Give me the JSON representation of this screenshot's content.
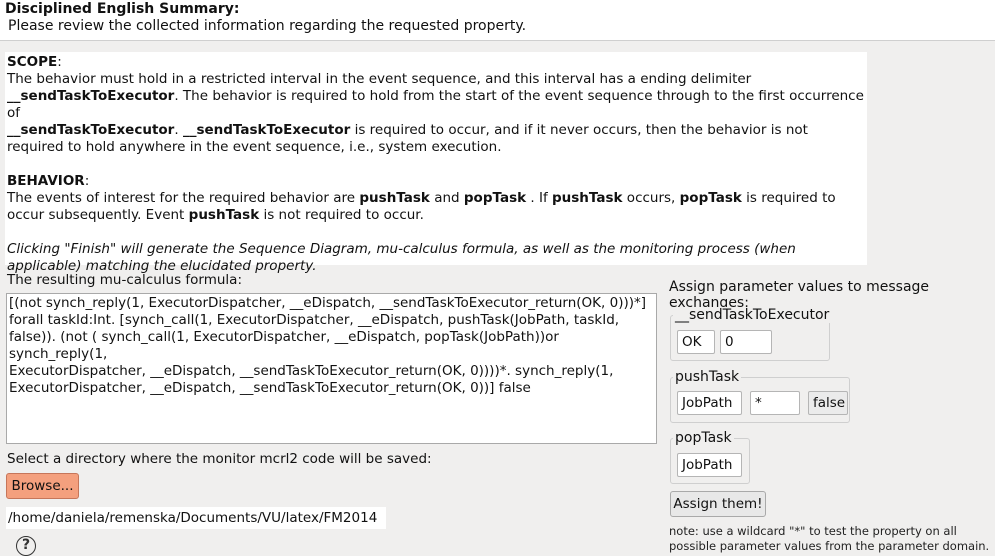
{
  "header": {
    "title": "Disciplined English Summary:",
    "subtitle": "Please review the collected information regarding the requested property."
  },
  "summary": {
    "scope_heading": "SCOPE",
    "scope_text_1": "The behavior must hold in a restricted interval in the event sequence, and this interval has a ending delimiter",
    "event_send": "__sendTaskToExecutor",
    "scope_text_2": ". The behavior is required to hold from the start of the event sequence through to the first occurrence of",
    "scope_text_3": ". ",
    "scope_text_4": " is required to occur, and if it never occurs, then the behavior is not required to hold anywhere in the event sequence, i.e., system execution.",
    "behavior_heading": "BEHAVIOR",
    "behavior_text_1": "The events of interest for the required behavior are ",
    "event_push": "pushTask",
    "behavior_text_2": " and ",
    "event_pop": "popTask",
    "behavior_text_3": " . If ",
    "behavior_text_4": " occurs, ",
    "behavior_text_5": " is required to occur subsequently. Event ",
    "behavior_text_6": " is not required to occur.",
    "finish_note": "Clicking \"Finish\" will generate the Sequence Diagram, mu-calculus formula, as well as the monitoring process (when applicable) matching the elucidated property."
  },
  "formula": {
    "label": "The resulting mu-calculus formula:",
    "text": "[(not synch_reply(1, ExecutorDispatcher, __eDispatch, __sendTaskToExecutor_return(OK, 0)))*]\nforall taskId:Int. [synch_call(1, ExecutorDispatcher, __eDispatch, pushTask(JobPath, taskId,\nfalse)). (not ( synch_call(1, ExecutorDispatcher, __eDispatch, popTask(JobPath))or synch_reply(1,\nExecutorDispatcher, __eDispatch, __sendTaskToExecutor_return(OK, 0))))*. synch_reply(1,\nExecutorDispatcher, __eDispatch, __sendTaskToExecutor_return(OK, 0))] false"
  },
  "directory": {
    "label": "Select a directory where the monitor mcrl2 code will be saved:",
    "browse_label": "Browse...",
    "path": "/home/daniela/remenska/Documents/VU/latex/FM2014"
  },
  "params": {
    "label": "Assign parameter values to message exchanges:",
    "groups": [
      {
        "title": "__sendTaskToExecutor",
        "fields": [
          "OK",
          "0"
        ]
      },
      {
        "title": "pushTask",
        "fields": [
          "JobPath",
          "*",
          "false"
        ]
      },
      {
        "title": "popTask",
        "fields": [
          "JobPath"
        ]
      }
    ],
    "assign_label": "Assign them!",
    "note": "note: use a wildcard \"*\" to test the property on all possible parameter values from the parameter domain."
  },
  "help_icon": "?",
  "colors": {
    "browse_button": "#f4a07e",
    "background": "#f0efee"
  }
}
